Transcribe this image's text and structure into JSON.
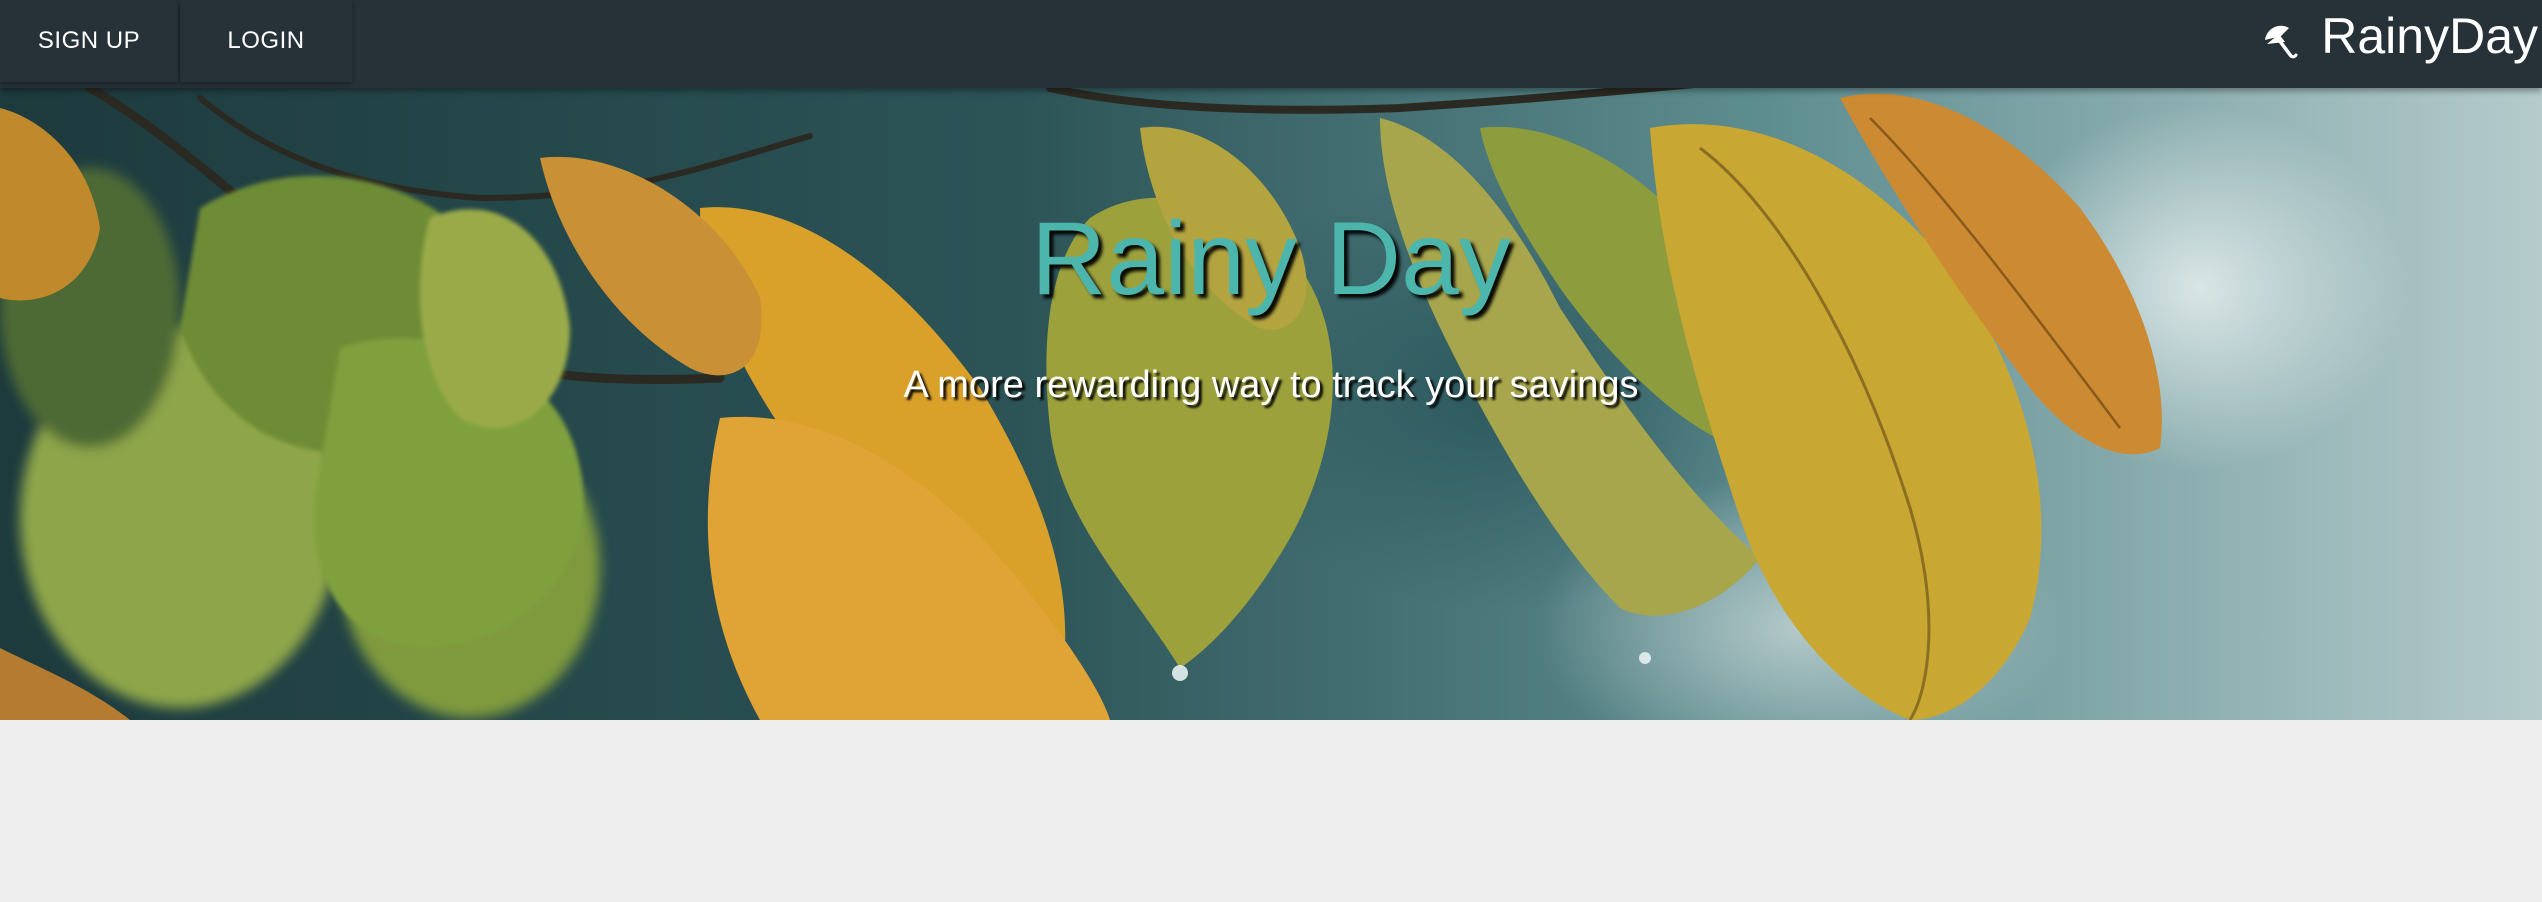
{
  "nav": {
    "links": [
      {
        "label": "SIGN UP"
      },
      {
        "label": "LOGIN"
      }
    ],
    "brand": {
      "name": "RainyDay",
      "icon": "umbrella-icon"
    }
  },
  "hero": {
    "title": "Rainy Day",
    "subtitle": "A more rewarding way to track your savings",
    "background": "autumn-leaves-photo"
  },
  "colors": {
    "navbar": "#263238",
    "accent": "#4db6ac",
    "page_background": "#eeeeee"
  }
}
